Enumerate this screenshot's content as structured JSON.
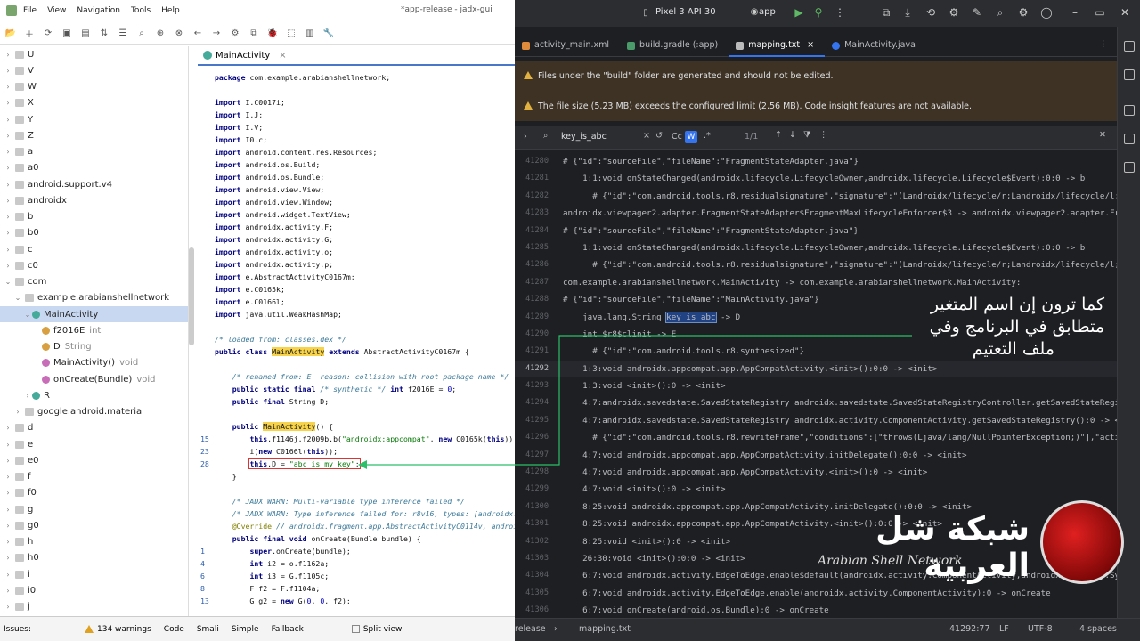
{
  "jadx": {
    "menu": [
      "File",
      "View",
      "Navigation",
      "Tools",
      "Help"
    ],
    "window_title": "*app-release - jadx-gui",
    "tree": [
      {
        "label": "U",
        "kind": "pkg",
        "arrow": "›",
        "indent": 1
      },
      {
        "label": "V",
        "kind": "pkg",
        "arrow": "›",
        "indent": 1
      },
      {
        "label": "W",
        "kind": "pkg",
        "arrow": "›",
        "indent": 1
      },
      {
        "label": "X",
        "kind": "pkg",
        "arrow": "›",
        "indent": 1
      },
      {
        "label": "Y",
        "kind": "pkg",
        "arrow": "›",
        "indent": 1
      },
      {
        "label": "Z",
        "kind": "pkg",
        "arrow": "›",
        "indent": 1
      },
      {
        "label": "a",
        "kind": "pkg",
        "arrow": "›",
        "indent": 1
      },
      {
        "label": "a0",
        "kind": "pkg",
        "arrow": "›",
        "indent": 1
      },
      {
        "label": "android.support.v4",
        "kind": "pkg",
        "arrow": "›",
        "indent": 1
      },
      {
        "label": "androidx",
        "kind": "pkg",
        "arrow": "›",
        "indent": 1
      },
      {
        "label": "b",
        "kind": "pkg",
        "arrow": "›",
        "indent": 1
      },
      {
        "label": "b0",
        "kind": "pkg",
        "arrow": "›",
        "indent": 1
      },
      {
        "label": "c",
        "kind": "pkg",
        "arrow": "›",
        "indent": 1
      },
      {
        "label": "c0",
        "kind": "pkg",
        "arrow": "›",
        "indent": 1
      },
      {
        "label": "com",
        "kind": "pkg",
        "arrow": "⌄",
        "indent": 1
      },
      {
        "label": "example.arabianshellnetwork",
        "kind": "pkg",
        "arrow": "⌄",
        "indent": 2
      },
      {
        "label": "MainActivity",
        "kind": "class",
        "arrow": "⌄",
        "indent": 3,
        "selected": true
      },
      {
        "label": "f2016E",
        "type": "int",
        "kind": "field",
        "indent": 4
      },
      {
        "label": "D",
        "type": "String",
        "kind": "field",
        "indent": 4
      },
      {
        "label": "MainActivity()",
        "type": "void",
        "kind": "method",
        "indent": 4
      },
      {
        "label": "onCreate(Bundle)",
        "type": "void",
        "kind": "method",
        "indent": 4
      },
      {
        "label": "R",
        "kind": "class",
        "arrow": "›",
        "indent": 3
      },
      {
        "label": "google.android.material",
        "kind": "pkg",
        "arrow": "›",
        "indent": 2
      },
      {
        "label": "d",
        "kind": "pkg",
        "arrow": "›",
        "indent": 1
      },
      {
        "label": "e",
        "kind": "pkg",
        "arrow": "›",
        "indent": 1
      },
      {
        "label": "e0",
        "kind": "pkg",
        "arrow": "›",
        "indent": 1
      },
      {
        "label": "f",
        "kind": "pkg",
        "arrow": "›",
        "indent": 1
      },
      {
        "label": "f0",
        "kind": "pkg",
        "arrow": "›",
        "indent": 1
      },
      {
        "label": "g",
        "kind": "pkg",
        "arrow": "›",
        "indent": 1
      },
      {
        "label": "g0",
        "kind": "pkg",
        "arrow": "›",
        "indent": 1
      },
      {
        "label": "h",
        "kind": "pkg",
        "arrow": "›",
        "indent": 1
      },
      {
        "label": "h0",
        "kind": "pkg",
        "arrow": "›",
        "indent": 1
      },
      {
        "label": "i",
        "kind": "pkg",
        "arrow": "›",
        "indent": 1
      },
      {
        "label": "i0",
        "kind": "pkg",
        "arrow": "›",
        "indent": 1
      },
      {
        "label": "j",
        "kind": "pkg",
        "arrow": "›",
        "indent": 1
      }
    ],
    "editor_tab": "MainActivity",
    "code": [
      {
        "ln": "",
        "html": "<span class=\"kw\">package</span> com.example.arabianshellnetwork;"
      },
      {
        "ln": "",
        "html": ""
      },
      {
        "ln": "",
        "html": "<span class=\"kw\">import</span> I.C0017i;"
      },
      {
        "ln": "",
        "html": "<span class=\"kw\">import</span> I.J;"
      },
      {
        "ln": "",
        "html": "<span class=\"kw\">import</span> I.V;"
      },
      {
        "ln": "",
        "html": "<span class=\"kw\">import</span> I0.c;"
      },
      {
        "ln": "",
        "html": "<span class=\"kw\">import</span> android.content.res.Resources;"
      },
      {
        "ln": "",
        "html": "<span class=\"kw\">import</span> android.os.Build;"
      },
      {
        "ln": "",
        "html": "<span class=\"kw\">import</span> android.os.Bundle;"
      },
      {
        "ln": "",
        "html": "<span class=\"kw\">import</span> android.view.View;"
      },
      {
        "ln": "",
        "html": "<span class=\"kw\">import</span> android.view.Window;"
      },
      {
        "ln": "",
        "html": "<span class=\"kw\">import</span> android.widget.TextView;"
      },
      {
        "ln": "",
        "html": "<span class=\"kw\">import</span> androidx.activity.F;"
      },
      {
        "ln": "",
        "html": "<span class=\"kw\">import</span> androidx.activity.G;"
      },
      {
        "ln": "",
        "html": "<span class=\"kw\">import</span> androidx.activity.o;"
      },
      {
        "ln": "",
        "html": "<span class=\"kw\">import</span> androidx.activity.p;"
      },
      {
        "ln": "",
        "html": "<span class=\"kw\">import</span> e.AbstractActivityC0167m;"
      },
      {
        "ln": "",
        "html": "<span class=\"kw\">import</span> e.C0165k;"
      },
      {
        "ln": "",
        "html": "<span class=\"kw\">import</span> e.C0166l;"
      },
      {
        "ln": "",
        "html": "<span class=\"kw\">import</span> java.util.WeakHashMap;"
      },
      {
        "ln": "",
        "html": ""
      },
      {
        "ln": "",
        "html": "<span class=\"cm\">/* loaded from: classes.dex */</span>"
      },
      {
        "ln": "",
        "html": "<span class=\"kw\">public class</span> <span class=\"hl\">MainActivity</span> <span class=\"kw\">extends</span> AbstractActivityC0167m {"
      },
      {
        "ln": "",
        "html": ""
      },
      {
        "ln": "",
        "html": "    <span class=\"cm\">/* renamed from: E  reason: collision with root package name */</span>"
      },
      {
        "ln": "",
        "html": "    <span class=\"kw\">public static final</span> <span class=\"cm\">/* synthetic */</span> <span class=\"kw\">int</span> f2016E = <span class=\"num\">0</span>;"
      },
      {
        "ln": "",
        "html": "    <span class=\"kw\">public final</span> String D;"
      },
      {
        "ln": "",
        "html": ""
      },
      {
        "ln": "",
        "html": "    <span class=\"kw\">public</span> <span class=\"hl\">MainActivity</span>() {"
      },
      {
        "ln": "15",
        "html": "        <span class=\"kw\">this</span>.f1146j.f2009b.b(<span class=\"st\">\"androidx:appcompat\"</span>, <span class=\"kw\">new</span> C0165k(<span class=\"kw\">this</span>));"
      },
      {
        "ln": "23",
        "html": "        i(<span class=\"kw\">new</span> C0166l(<span class=\"kw\">this</span>));"
      },
      {
        "ln": "28",
        "html": "        <span class=\"redbox\"><span class=\"kw\">this</span>.D = <span class=\"st\">\"abc is my key\"</span>;</span>"
      },
      {
        "ln": "",
        "html": "    }"
      },
      {
        "ln": "",
        "html": ""
      },
      {
        "ln": "",
        "html": "    <span class=\"cm\">/* JADX WARN: Multi-variable type inference failed */</span>"
      },
      {
        "ln": "",
        "html": "    <span class=\"cm\">/* JADX WARN: Type inference failed for: r8v16, types: [androidx.activ</span>"
      },
      {
        "ln": "",
        "html": "    <span class=\"ann\">@Override</span> <span class=\"cm\">// androidx.fragment.app.AbstractActivityC0114v, androidx.a</span>"
      },
      {
        "ln": "",
        "html": "    <span class=\"kw\">public final void</span> onCreate(Bundle bundle) {"
      },
      {
        "ln": "1",
        "html": "        <span class=\"kw\">super</span>.onCreate(bundle);"
      },
      {
        "ln": "4",
        "html": "        <span class=\"kw\">int</span> i2 = o.f1162a;"
      },
      {
        "ln": "6",
        "html": "        <span class=\"kw\">int</span> i3 = G.f1105c;"
      },
      {
        "ln": "8",
        "html": "        F f2 = F.f1104a;"
      },
      {
        "ln": "13",
        "html": "        G g2 = <span class=\"kw\">new</span> G(<span class=\"num\">0</span>, <span class=\"num\">0</span>, f2);"
      }
    ],
    "status": {
      "issues": "Issues:",
      "warnings": "134 warnings",
      "tabs": [
        "Code",
        "Smali",
        "Simple",
        "Fallback"
      ],
      "split": "Split view"
    }
  },
  "studio": {
    "device": "Pixel 3 API 30",
    "app": "app",
    "tabs": [
      "activity_main.xml",
      "build.gradle (:app)",
      "mapping.txt",
      "MainActivity.java"
    ],
    "active_tab": 2,
    "banner1": "Files under the \"build\" folder are generated and should not be edited.",
    "banner2": "The file size (5.23 MB) exceeds the configured limit (2.56 MB). Code insight features are not available.",
    "search_query": "key_is_abc",
    "search_count": "1/1",
    "lines": [
      {
        "ln": "41280",
        "html": "# {\"id\":\"sourceFile\",\"fileName\":\"FragmentStateAdapter.java\"}"
      },
      {
        "ln": "41281",
        "html": "    1:1:void onStateChanged(androidx.lifecycle.LifecycleOwner,androidx.lifecycle.Lifecycle$Event):0:0 -> b"
      },
      {
        "ln": "41282",
        "html": "      # {\"id\":\"com.android.tools.r8.residualsignature\",\"signature\":\"(Landroidx/lifecycle/r;Landroidx/lifecycle/l;)V\"}"
      },
      {
        "ln": "41283",
        "html": "androidx.viewpager2.adapter.FragmentStateAdapter$FragmentMaxLifecycleEnforcer$3 -> androidx.viewpager2.adapter.FragmentSt"
      },
      {
        "ln": "41284",
        "html": "# {\"id\":\"sourceFile\",\"fileName\":\"FragmentStateAdapter.java\"}"
      },
      {
        "ln": "41285",
        "html": "    1:1:void onStateChanged(androidx.lifecycle.LifecycleOwner,androidx.lifecycle.Lifecycle$Event):0:0 -> b"
      },
      {
        "ln": "41286",
        "html": "      # {\"id\":\"com.android.tools.r8.residualsignature\",\"signature\":\"(Landroidx/lifecycle/r;Landroidx/lifecycle/l;)V\"}"
      },
      {
        "ln": "41287",
        "html": "com.example.arabianshellnetwork.MainActivity -> com.example.arabianshellnetwork.MainActivity:"
      },
      {
        "ln": "41288",
        "html": "# {\"id\":\"sourceFile\",\"fileName\":\"MainActivity.java\"}"
      },
      {
        "ln": "41289",
        "html": "    java.lang.String <span class=\"sm\">key_is_abc</span> -> D"
      },
      {
        "ln": "41290",
        "html": "    int $r8$clinit -> E"
      },
      {
        "ln": "41291",
        "html": "      # {\"id\":\"com.android.tools.r8.synthesized\"}"
      },
      {
        "ln": "41292",
        "html": "    1:3:void androidx.appcompat.app.AppCompatActivity.<init>():0:0 -> <init>",
        "cur": true
      },
      {
        "ln": "41293",
        "html": "    1:3:void <init>():0 -> <init>"
      },
      {
        "ln": "41294",
        "html": "    4:7:androidx.savedstate.SavedStateRegistry androidx.savedstate.SavedStateRegistryController.getSavedStateRegistry():0"
      },
      {
        "ln": "41295",
        "html": "    4:7:androidx.savedstate.SavedStateRegistry androidx.activity.ComponentActivity.getSavedStateRegistry():0 -> <init>"
      },
      {
        "ln": "41296",
        "html": "      # {\"id\":\"com.android.tools.r8.rewriteFrame\",\"conditions\":[\"throws(Ljava/lang/NullPointerException;)\"],\"actions\":[\"r"
      },
      {
        "ln": "41297",
        "html": "    4:7:void androidx.appcompat.app.AppCompatActivity.initDelegate():0:0 -> <init>"
      },
      {
        "ln": "41298",
        "html": "    4:7:void androidx.appcompat.app.AppCompatActivity.<init>():0 -> <init>"
      },
      {
        "ln": "41299",
        "html": "    4:7:void <init>():0 -> <init>"
      },
      {
        "ln": "41300",
        "html": "    8:25:void androidx.appcompat.app.AppCompatActivity.initDelegate():0:0 -> <init>"
      },
      {
        "ln": "41301",
        "html": "    8:25:void androidx.appcompat.app.AppCompatActivity.<init>():0:0 -> <init>"
      },
      {
        "ln": "41302",
        "html": "    8:25:void <init>():0 -> <init>"
      },
      {
        "ln": "41303",
        "html": "    26:30:void <init>():0:0 -> <init>"
      },
      {
        "ln": "41304",
        "html": "    6:7:void androidx.activity.EdgeToEdge.enable$default(androidx.activity.ComponentActivity,androidx.activity.SystemBarS"
      },
      {
        "ln": "41305",
        "html": "    6:7:void androidx.activity.EdgeToEdge.enable(androidx.activity.ComponentActivity):0 -> onCreate"
      },
      {
        "ln": "41306",
        "html": "    6:7:void onCreate(android.os.Bundle):0 -> onCreate"
      }
    ],
    "status": {
      "left": "release",
      "file": "mapping.txt",
      "pos": "41292:77",
      "lf": "LF",
      "enc": "UTF-8",
      "indent": "4 spaces"
    }
  },
  "overlay": {
    "arabic_lines": [
      "كما ترون إن اسم المتغير",
      "متطابق في البرنامج وفي",
      "ملف التعتيم"
    ],
    "logo_text": "شبكة شل العربية",
    "logo_sub": "Arabian Shell Network"
  }
}
